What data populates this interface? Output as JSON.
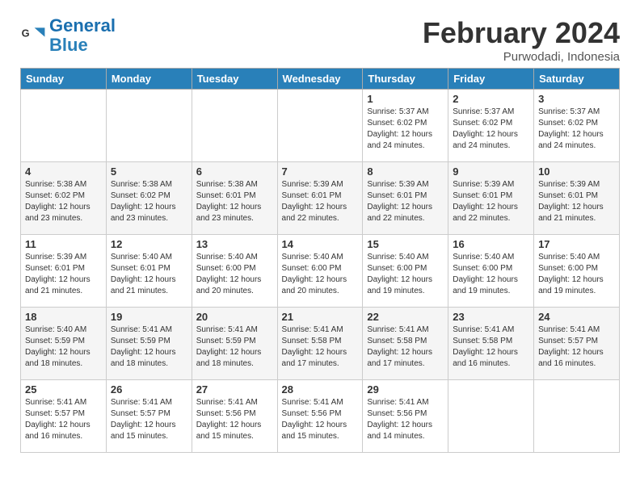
{
  "header": {
    "logo_line1": "General",
    "logo_line2": "Blue",
    "month": "February 2024",
    "location": "Purwodadi, Indonesia"
  },
  "days_of_week": [
    "Sunday",
    "Monday",
    "Tuesday",
    "Wednesday",
    "Thursday",
    "Friday",
    "Saturday"
  ],
  "weeks": [
    [
      {
        "day": "",
        "info": ""
      },
      {
        "day": "",
        "info": ""
      },
      {
        "day": "",
        "info": ""
      },
      {
        "day": "",
        "info": ""
      },
      {
        "day": "1",
        "info": "Sunrise: 5:37 AM\nSunset: 6:02 PM\nDaylight: 12 hours\nand 24 minutes."
      },
      {
        "day": "2",
        "info": "Sunrise: 5:37 AM\nSunset: 6:02 PM\nDaylight: 12 hours\nand 24 minutes."
      },
      {
        "day": "3",
        "info": "Sunrise: 5:37 AM\nSunset: 6:02 PM\nDaylight: 12 hours\nand 24 minutes."
      }
    ],
    [
      {
        "day": "4",
        "info": "Sunrise: 5:38 AM\nSunset: 6:02 PM\nDaylight: 12 hours\nand 23 minutes."
      },
      {
        "day": "5",
        "info": "Sunrise: 5:38 AM\nSunset: 6:02 PM\nDaylight: 12 hours\nand 23 minutes."
      },
      {
        "day": "6",
        "info": "Sunrise: 5:38 AM\nSunset: 6:01 PM\nDaylight: 12 hours\nand 23 minutes."
      },
      {
        "day": "7",
        "info": "Sunrise: 5:39 AM\nSunset: 6:01 PM\nDaylight: 12 hours\nand 22 minutes."
      },
      {
        "day": "8",
        "info": "Sunrise: 5:39 AM\nSunset: 6:01 PM\nDaylight: 12 hours\nand 22 minutes."
      },
      {
        "day": "9",
        "info": "Sunrise: 5:39 AM\nSunset: 6:01 PM\nDaylight: 12 hours\nand 22 minutes."
      },
      {
        "day": "10",
        "info": "Sunrise: 5:39 AM\nSunset: 6:01 PM\nDaylight: 12 hours\nand 21 minutes."
      }
    ],
    [
      {
        "day": "11",
        "info": "Sunrise: 5:39 AM\nSunset: 6:01 PM\nDaylight: 12 hours\nand 21 minutes."
      },
      {
        "day": "12",
        "info": "Sunrise: 5:40 AM\nSunset: 6:01 PM\nDaylight: 12 hours\nand 21 minutes."
      },
      {
        "day": "13",
        "info": "Sunrise: 5:40 AM\nSunset: 6:00 PM\nDaylight: 12 hours\nand 20 minutes."
      },
      {
        "day": "14",
        "info": "Sunrise: 5:40 AM\nSunset: 6:00 PM\nDaylight: 12 hours\nand 20 minutes."
      },
      {
        "day": "15",
        "info": "Sunrise: 5:40 AM\nSunset: 6:00 PM\nDaylight: 12 hours\nand 19 minutes."
      },
      {
        "day": "16",
        "info": "Sunrise: 5:40 AM\nSunset: 6:00 PM\nDaylight: 12 hours\nand 19 minutes."
      },
      {
        "day": "17",
        "info": "Sunrise: 5:40 AM\nSunset: 6:00 PM\nDaylight: 12 hours\nand 19 minutes."
      }
    ],
    [
      {
        "day": "18",
        "info": "Sunrise: 5:40 AM\nSunset: 5:59 PM\nDaylight: 12 hours\nand 18 minutes."
      },
      {
        "day": "19",
        "info": "Sunrise: 5:41 AM\nSunset: 5:59 PM\nDaylight: 12 hours\nand 18 minutes."
      },
      {
        "day": "20",
        "info": "Sunrise: 5:41 AM\nSunset: 5:59 PM\nDaylight: 12 hours\nand 18 minutes."
      },
      {
        "day": "21",
        "info": "Sunrise: 5:41 AM\nSunset: 5:58 PM\nDaylight: 12 hours\nand 17 minutes."
      },
      {
        "day": "22",
        "info": "Sunrise: 5:41 AM\nSunset: 5:58 PM\nDaylight: 12 hours\nand 17 minutes."
      },
      {
        "day": "23",
        "info": "Sunrise: 5:41 AM\nSunset: 5:58 PM\nDaylight: 12 hours\nand 16 minutes."
      },
      {
        "day": "24",
        "info": "Sunrise: 5:41 AM\nSunset: 5:57 PM\nDaylight: 12 hours\nand 16 minutes."
      }
    ],
    [
      {
        "day": "25",
        "info": "Sunrise: 5:41 AM\nSunset: 5:57 PM\nDaylight: 12 hours\nand 16 minutes."
      },
      {
        "day": "26",
        "info": "Sunrise: 5:41 AM\nSunset: 5:57 PM\nDaylight: 12 hours\nand 15 minutes."
      },
      {
        "day": "27",
        "info": "Sunrise: 5:41 AM\nSunset: 5:56 PM\nDaylight: 12 hours\nand 15 minutes."
      },
      {
        "day": "28",
        "info": "Sunrise: 5:41 AM\nSunset: 5:56 PM\nDaylight: 12 hours\nand 15 minutes."
      },
      {
        "day": "29",
        "info": "Sunrise: 5:41 AM\nSunset: 5:56 PM\nDaylight: 12 hours\nand 14 minutes."
      },
      {
        "day": "",
        "info": ""
      },
      {
        "day": "",
        "info": ""
      }
    ]
  ]
}
